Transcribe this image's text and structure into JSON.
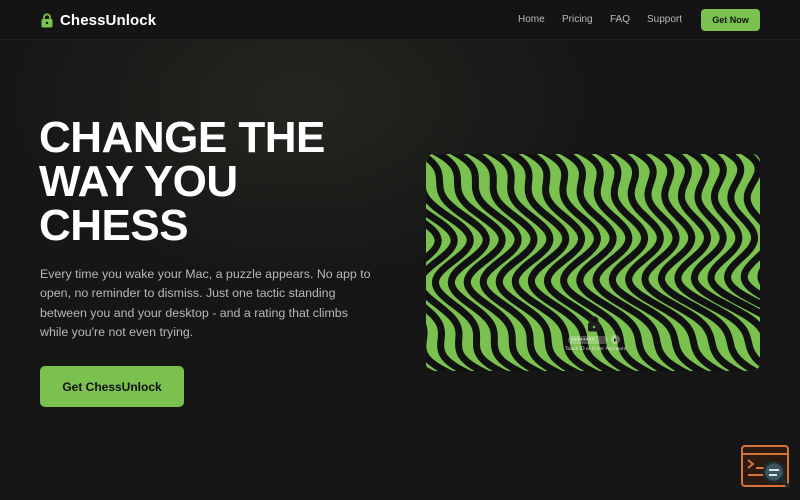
{
  "header": {
    "brand": "ChessUnlock",
    "nav": [
      "Home",
      "Pricing",
      "FAQ",
      "Support"
    ],
    "cta_label": "Get Now"
  },
  "hero": {
    "title_lines": [
      "CHANGE THE",
      "WAY YOU",
      "CHESS"
    ],
    "description": "Every time you wake your Mac, a puzzle appears. No app to open, no reminder to dismiss. Just one tactic standing between you and your desktop - and a rating that climbs while you're not even trying.",
    "cta_label": "Get ChessUnlock"
  },
  "screen": {
    "password_mask": "••••••••",
    "hint": "Touch ID or Enter Password"
  },
  "icons": {
    "brand": "lock-icon",
    "screen_lock": "lock-icon",
    "widget": "terminal-search-icon"
  },
  "colors": {
    "background": "#161616",
    "accent": "#7ac14f",
    "wave_dark": "#111111",
    "text_muted": "#b8b8b8",
    "widget": "#d8743a"
  }
}
